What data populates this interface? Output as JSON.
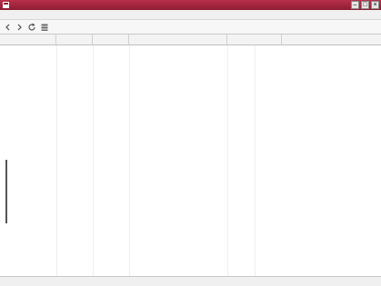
{
  "window": {
    "title": "",
    "title_bar_color": "#8e1c33"
  },
  "menu": [
    "",
    "",
    "",
    ""
  ],
  "toolbar": [
    "arrow-left-icon",
    "arrow-right-icon",
    "refresh-icon",
    "view-icon"
  ],
  "list": {
    "columns": [
      "",
      "",
      "",
      "",
      ""
    ],
    "rows": [
      [
        "",
        "",
        "",
        "",
        ""
      ],
      [
        "",
        "",
        "",
        "",
        ""
      ],
      [
        "",
        "",
        "",
        "",
        ""
      ],
      [
        "",
        "",
        "",
        "",
        ""
      ],
      [
        "",
        "",
        "",
        "",
        ""
      ],
      [
        "",
        "",
        "",
        "",
        ""
      ],
      [
        "",
        "",
        "",
        "",
        ""
      ],
      [
        "",
        "",
        "",
        "",
        ""
      ],
      [
        "",
        "",
        "",
        "",
        ""
      ],
      [
        "",
        "",
        "",
        "",
        ""
      ],
      [
        "",
        "",
        "",
        "",
        ""
      ],
      [
        "",
        "",
        "",
        "",
        ""
      ],
      [
        "",
        "",
        "",
        "",
        ""
      ],
      [
        "",
        "",
        "",
        "",
        ""
      ],
      [
        "",
        "",
        "",
        "",
        ""
      ],
      [
        "",
        "",
        "",
        "",
        ""
      ],
      [
        "",
        "",
        "",
        "",
        ""
      ],
      [
        "",
        "",
        "",
        "",
        ""
      ],
      [
        "",
        "",
        "",
        "",
        ""
      ],
      [
        "",
        "",
        "",
        "",
        ""
      ],
      [
        "",
        "",
        "",
        "",
        ""
      ],
      [
        "",
        "",
        "",
        "",
        ""
      ],
      [
        "",
        "",
        "",
        "",
        ""
      ],
      [
        "",
        "",
        "",
        "",
        ""
      ],
      [
        "",
        "",
        "",
        "",
        ""
      ],
      [
        "",
        "",
        "",
        "",
        ""
      ],
      [
        "",
        "",
        "",
        "",
        ""
      ],
      [
        "",
        "",
        "",
        "",
        ""
      ],
      [
        "",
        "",
        "",
        "",
        ""
      ],
      [
        "",
        "",
        "",
        "",
        ""
      ],
      [
        "",
        "",
        "",
        "",
        ""
      ],
      [
        "",
        "",
        "",
        "",
        ""
      ],
      [
        "",
        "",
        "",
        "",
        ""
      ],
      [
        "",
        "",
        "",
        "",
        ""
      ]
    ]
  },
  "status": {
    "left": "",
    "right": ""
  }
}
